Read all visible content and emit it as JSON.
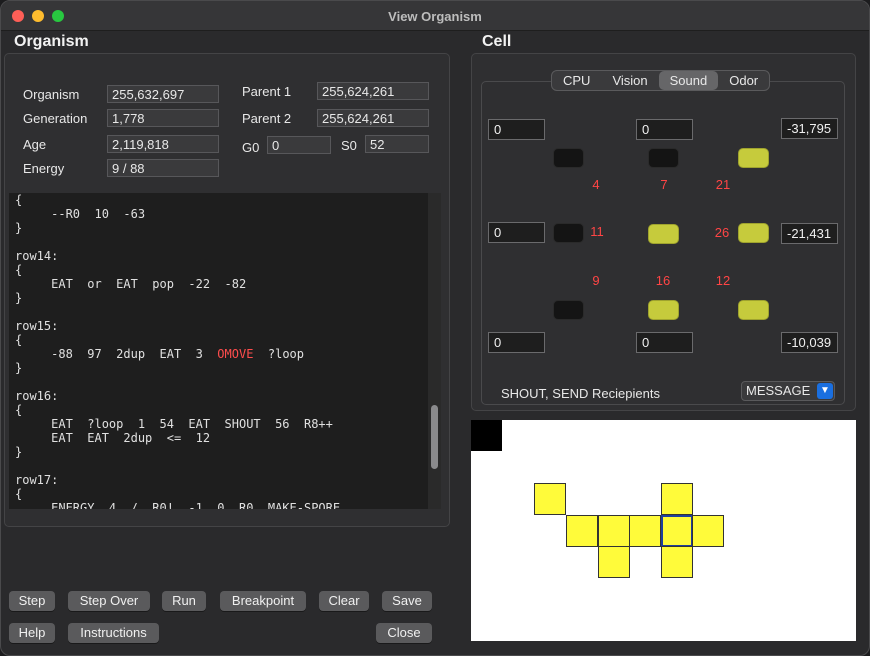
{
  "window": {
    "title": "View Organism"
  },
  "organism": {
    "section_title": "Organism",
    "fields": {
      "organism_label": "Organism",
      "organism_value": "255,632,697",
      "generation_label": "Generation",
      "generation_value": "1,778",
      "age_label": "Age",
      "age_value": "2,119,818",
      "energy_label": "Energy",
      "energy_value": "9 / 88",
      "parent1_label": "Parent 1",
      "parent1_value": "255,624,261",
      "parent2_label": "Parent 2",
      "parent2_value": "255,624,261",
      "g0_label": "G0",
      "g0_value": "0",
      "s0_label": "S0",
      "s0_value": "52"
    },
    "code_lines": [
      "{",
      "     --R0  10  -63",
      "}",
      "",
      "row14:",
      "{",
      "     EAT  or  EAT  pop  -22  -82",
      "}",
      "",
      "row15:",
      "{",
      "     -88  97  2dup  EAT  3  OMOVE  ?loop",
      "}",
      "",
      "row16:",
      "{",
      "     EAT  ?loop  1  54  EAT  SHOUT  56  R8++",
      "     EAT  EAT  2dup  <=  12",
      "}",
      "",
      "row17:",
      "{",
      "     ENERGY  4  /  R0!  -1  0  R0  MAKE-SPORE"
    ],
    "highlight_token": "OMOVE"
  },
  "cell": {
    "section_title": "Cell",
    "tabs": [
      "CPU",
      "Vision",
      "Sound",
      "Odor"
    ],
    "active_tab": "Sound",
    "inputs": {
      "top_left": "0",
      "top_mid": "0",
      "top_right": "-31,795",
      "mid_left": "0",
      "mid_right": "-21,431",
      "bot_left": "0",
      "bot_mid": "0",
      "bot_right": "-10,039"
    },
    "numbers": {
      "n4": "4",
      "n7": "7",
      "n21": "21",
      "n11": "11",
      "n26": "26",
      "n9": "9",
      "n16": "16",
      "n12": "12"
    },
    "recipients_label": "SHOUT, SEND Reciepients",
    "message_select": "MESSAGE",
    "colors": {
      "led_on": "#c6cb3c",
      "led_off": "#141414",
      "cell_fill": "#fffb3a",
      "number_red": "#ff4545"
    }
  },
  "buttons": {
    "step": "Step",
    "step_over": "Step Over",
    "run": "Run",
    "breakpoint": "Breakpoint",
    "clear": "Clear",
    "save": "Save",
    "help": "Help",
    "instructions": "Instructions",
    "close": "Close"
  }
}
